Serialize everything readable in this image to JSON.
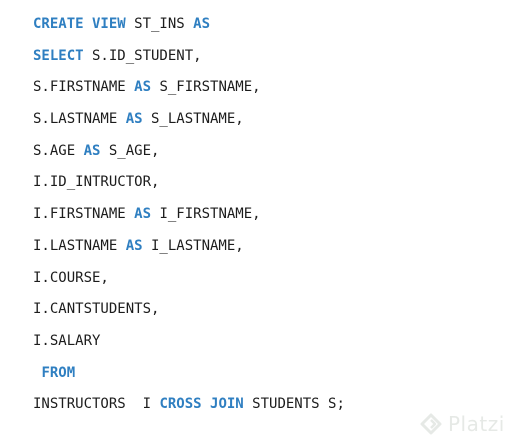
{
  "code_lines": [
    [
      {
        "text": "CREATE VIEW",
        "kw": true
      },
      {
        "text": " ST_INS ",
        "kw": false
      },
      {
        "text": "AS",
        "kw": true
      }
    ],
    [
      {
        "text": "SELECT",
        "kw": true
      },
      {
        "text": " S.ID_STUDENT,",
        "kw": false
      }
    ],
    [
      {
        "text": "S.FIRSTNAME ",
        "kw": false
      },
      {
        "text": "AS",
        "kw": true
      },
      {
        "text": " S_FIRSTNAME,",
        "kw": false
      }
    ],
    [
      {
        "text": "S.LASTNAME ",
        "kw": false
      },
      {
        "text": "AS",
        "kw": true
      },
      {
        "text": " S_LASTNAME,",
        "kw": false
      }
    ],
    [
      {
        "text": "S.AGE ",
        "kw": false
      },
      {
        "text": "AS",
        "kw": true
      },
      {
        "text": " S_AGE,",
        "kw": false
      }
    ],
    [
      {
        "text": "I.ID_INTRUCTOR,",
        "kw": false
      }
    ],
    [
      {
        "text": "I.FIRSTNAME ",
        "kw": false
      },
      {
        "text": "AS",
        "kw": true
      },
      {
        "text": " I_FIRSTNAME,",
        "kw": false
      }
    ],
    [
      {
        "text": "I.LASTNAME ",
        "kw": false
      },
      {
        "text": "AS",
        "kw": true
      },
      {
        "text": " I_LASTNAME,",
        "kw": false
      }
    ],
    [
      {
        "text": "I.COURSE,",
        "kw": false
      }
    ],
    [
      {
        "text": "I.CANTSTUDENTS,",
        "kw": false
      }
    ],
    [
      {
        "text": "I.SALARY",
        "kw": false
      }
    ],
    [
      {
        "text": " ",
        "kw": false
      },
      {
        "text": "FROM",
        "kw": true
      }
    ],
    [
      {
        "text": "INSTRUCTORS  I ",
        "kw": false
      },
      {
        "text": "CROSS JOIN",
        "kw": true
      },
      {
        "text": " STUDENTS S;",
        "kw": false
      }
    ]
  ],
  "watermark": {
    "text": "Platzi",
    "icon": "platzi-logo-icon"
  },
  "colors": {
    "keyword": "#2f7fc1",
    "text": "#1c1c1c",
    "background": "#ffffff"
  }
}
